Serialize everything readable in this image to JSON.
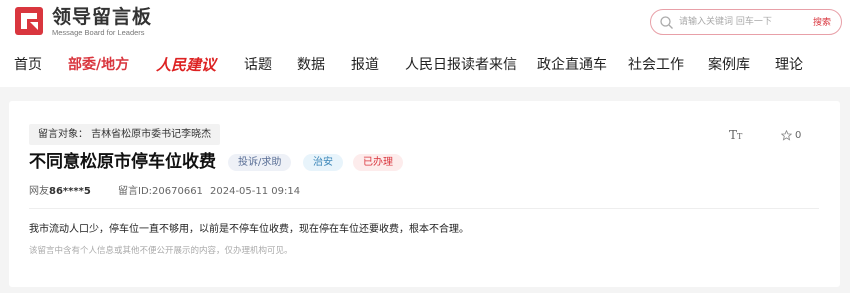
{
  "site": {
    "logo_cn": "领导留言板",
    "logo_en": "Message Board for Leaders"
  },
  "search": {
    "placeholder": "请输入关键词 回车一下",
    "button": "搜索"
  },
  "nav": {
    "items": [
      {
        "label": "首页"
      },
      {
        "label": "部委/地方"
      },
      {
        "label": "人民建议"
      },
      {
        "label": "话题"
      },
      {
        "label": "数据"
      },
      {
        "label": "报道"
      },
      {
        "label": "人民日报读者来信"
      },
      {
        "label": "政企直通车"
      },
      {
        "label": "社会工作"
      },
      {
        "label": "案例库"
      },
      {
        "label": "理论"
      }
    ],
    "active_index": 1
  },
  "message": {
    "target": "留言对象：  吉林省松原市委书记李晓杰",
    "title": "不同意松原市停车位收费",
    "tags": {
      "type": "投诉/求助",
      "field": "治安",
      "status": "已办理"
    },
    "user_prefix": "网友",
    "user_id": "86****5",
    "message_id": "留言ID:20670661",
    "datetime": "2024-05-11 09:14",
    "content": "我市流动人口少，停车位一直不够用，以前是不停车位收费，现在停在车位还要收费，根本不合理。",
    "note": "该留言中含有个人信息或其他不便公开展示的内容，仅办理机构可见。",
    "likes": "0"
  },
  "colors": {
    "accent": "#d9363e",
    "tag_type_bg": "#eef1f7",
    "tag_field_bg": "#e8f4fb",
    "tag_status_bg": "#fdecec"
  }
}
